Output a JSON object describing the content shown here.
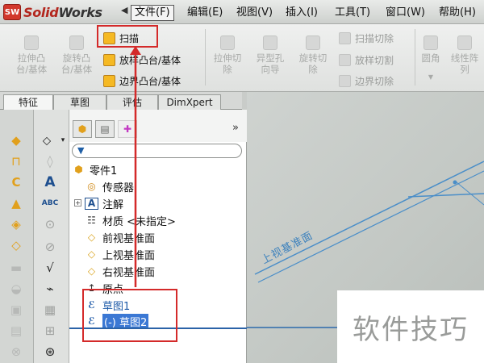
{
  "app": {
    "logo_badge": "SW",
    "logo_solid": "Solid",
    "logo_works": "Works"
  },
  "menu": {
    "collapse_arrow": "◀",
    "items": [
      "文件(F)",
      "编辑(E)",
      "视图(V)",
      "插入(I)",
      "工具(T)",
      "窗口(W)",
      "帮助(H)"
    ]
  },
  "ribbon": {
    "extrude_boss": "拉伸凸\n台/基体",
    "revolve_boss": "旋转凸\n台/基体",
    "sweep": "扫描",
    "loft_boss": "放样凸台/基体",
    "boundary_boss": "边界凸台/基体",
    "extrude_cut": "拉伸切\n除",
    "hole_wizard": "异型孔\n向导",
    "revolve_cut": "旋转切\n除",
    "sweep_cut": "扫描切除",
    "loft_cut": "放样切割",
    "boundary_cut": "边界切除",
    "fillet": "圆角",
    "linear_pattern": "线性阵\n列"
  },
  "tabs": [
    "特征",
    "草图",
    "评估",
    "DimXpert"
  ],
  "panel": {
    "more": "»",
    "tree": {
      "part": "零件1",
      "sensors": "传感器",
      "annotations": "注解",
      "material": "材质 <未指定>",
      "front_plane": "前视基准面",
      "top_plane": "上视基准面",
      "right_plane": "右视基准面",
      "origin": "原点",
      "sketch1": "草图1",
      "sketch2": "(-) 草图2"
    }
  },
  "viewport": {
    "plane_label": "上视基准面"
  },
  "watermark": "软件技巧",
  "colors": {
    "annotation_red": "#d42a2a",
    "selection_blue": "#3b78d4",
    "plane_blue": "#3e82bd"
  }
}
